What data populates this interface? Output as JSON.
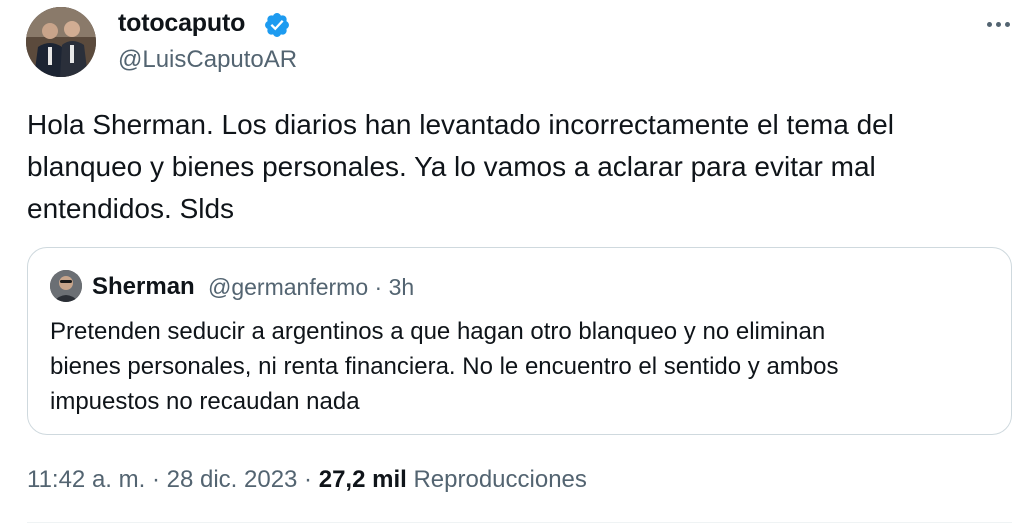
{
  "tweet": {
    "author": {
      "name": "totocaputo",
      "handle": "@LuisCaputoAR",
      "verified": true
    },
    "text": "Hola Sherman. Los diarios han levantado incorrectamente el tema del\nblanqueo y bienes personales. Ya lo vamos a aclarar para evitar mal\nentendidos. Slds",
    "quoted": {
      "name": "Sherman",
      "meta": "@germanfermo · 3h",
      "text": "Pretenden seducir a argentinos a que hagan otro blanqueo y no eliminan\nbienes personales, ni renta financiera. No le encuentro el sentido y ambos\nimpuestos no recaudan nada"
    },
    "footer": {
      "time_date": "11:42 a. m. · 28 dic. 2023 · ",
      "views": "27,2 mil",
      "views_label": "Reproducciones"
    }
  },
  "colors": {
    "text": "#0f1419",
    "secondary": "#536471",
    "border": "#cfd9de",
    "verified": "#1d9bf0"
  },
  "icons": {
    "verified": "verified-badge-icon",
    "more": "more-options-icon"
  }
}
